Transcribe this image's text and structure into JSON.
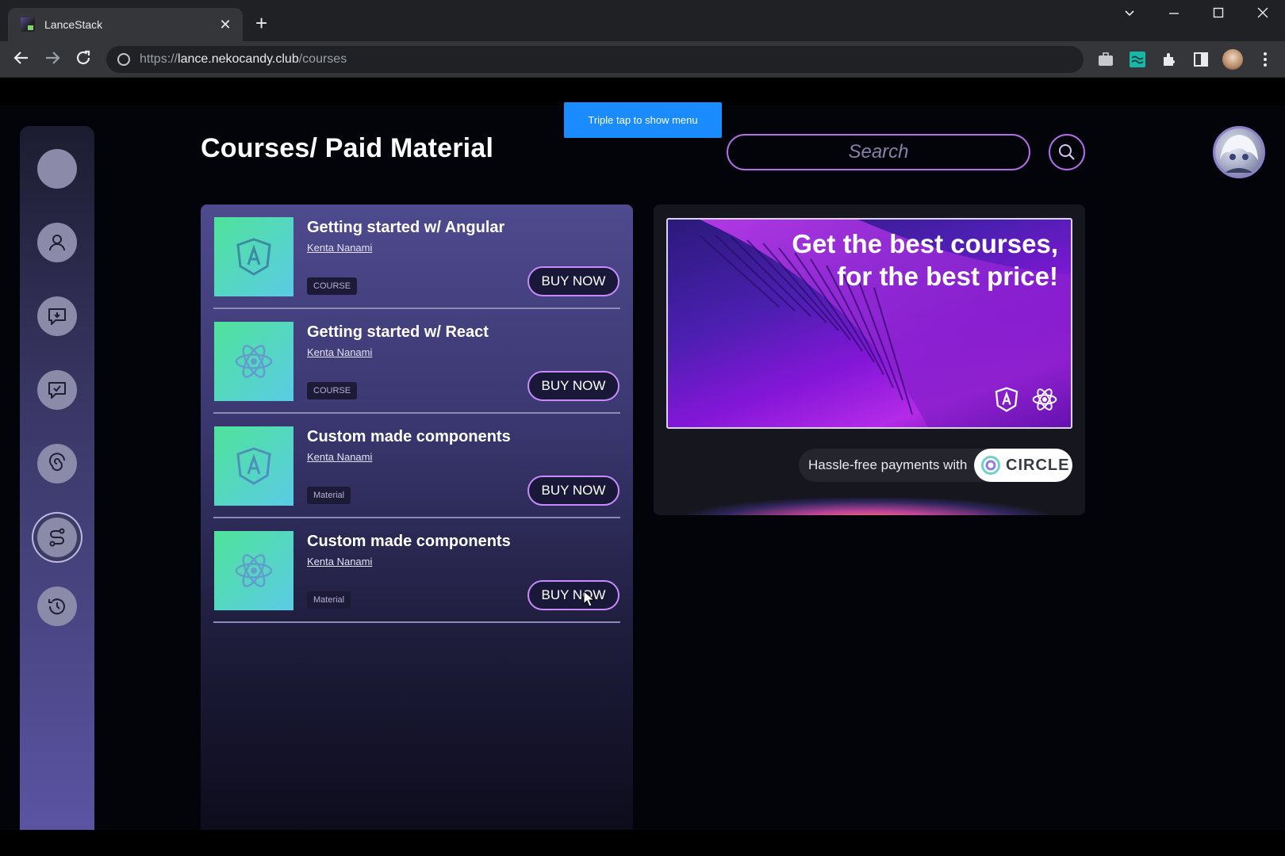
{
  "browser": {
    "tab_title": "LanceStack",
    "url_scheme": "https://",
    "url_host": "lance.nekocandy.club",
    "url_path": "/courses"
  },
  "tooltip": "Triple tap to show menu",
  "page": {
    "title": "Courses/ Paid Material",
    "search_placeholder": "Search"
  },
  "courses": [
    {
      "title": "Getting started w/ Angular",
      "author": "Kenta Nanami",
      "badge": "COURSE",
      "button": "BUY NOW",
      "icon": "angular-icon"
    },
    {
      "title": "Getting started w/ React",
      "author": "Kenta Nanami",
      "badge": "COURSE",
      "button": "BUY NOW",
      "icon": "react-icon"
    },
    {
      "title": "Custom made components",
      "author": "Kenta Nanami",
      "badge": "Material",
      "button": "BUY NOW",
      "icon": "angular-icon"
    },
    {
      "title": "Custom made components",
      "author": "Kenta Nanami",
      "badge": "Material",
      "button": "BUY NOW",
      "icon": "react-icon"
    }
  ],
  "promo": {
    "headline_line1": "Get the best courses,",
    "headline_line2": "for the best price!",
    "payments_text": "Hassle-free payments with",
    "payments_brand": "CIRCLE"
  },
  "sidebar": {
    "icons": [
      "profile-circle-icon",
      "user-icon",
      "chat-download-icon",
      "chat-check-icon",
      "spiral-icon",
      "route-icon",
      "history-icon"
    ],
    "active": "route-icon"
  },
  "colors": {
    "accent": "#b26ee8",
    "tooltip": "#1a8cff",
    "thumb_gradient_start": "#4fe39a",
    "thumb_gradient_end": "#5acbe6"
  }
}
